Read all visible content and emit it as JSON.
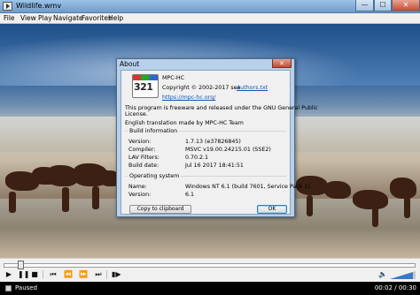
{
  "window": {
    "title": "Wildlife.wmv"
  },
  "window_buttons": {
    "minimize": "—",
    "maximize": "☐",
    "close": "✕"
  },
  "menu": [
    "File",
    "View",
    "Play",
    "Navigate",
    "Favorites",
    "Help"
  ],
  "about": {
    "title": "About",
    "close": "✕",
    "logo_text": "321",
    "app_name": "MPC-HC",
    "copyright": "Copyright © 2002-2017 see",
    "authors_link": "Authors.txt",
    "website_link": "https://mpc-hc.org/",
    "license_line1": "This program is freeware and released under the GNU General Public",
    "license_line2": "License.",
    "translation": "English translation made by MPC-HC Team",
    "build_group": "Build information",
    "build_rows": [
      {
        "label": "Version:",
        "value": "1.7.13 (e37826845)"
      },
      {
        "label": "Compiler:",
        "value": "MSVC v19.00.24215.01 (SSE2)"
      },
      {
        "label": "LAV Filters:",
        "value": "0.70.2.1"
      },
      {
        "label": "Build date:",
        "value": "Jul 16 2017 18:41:51"
      }
    ],
    "os_group": "Operating system",
    "os_rows": [
      {
        "label": "Name:",
        "value": "Windows NT 6.1 (build 7601, Service Pack 1)"
      },
      {
        "label": "Version:",
        "value": "6.1"
      }
    ],
    "copy_button": "Copy to clipboard",
    "ok_button": "OK"
  },
  "player": {
    "seek_position": 0.04,
    "volume_level": 0.93,
    "status": "Paused",
    "time": "00:02 / 00:30"
  },
  "icons": [
    "app-icon",
    "play-icon",
    "pause-icon",
    "stop-icon",
    "skip-back-icon",
    "rewind-icon",
    "fast-forward-icon",
    "skip-forward-icon",
    "frame-step-icon",
    "speaker-icon"
  ]
}
